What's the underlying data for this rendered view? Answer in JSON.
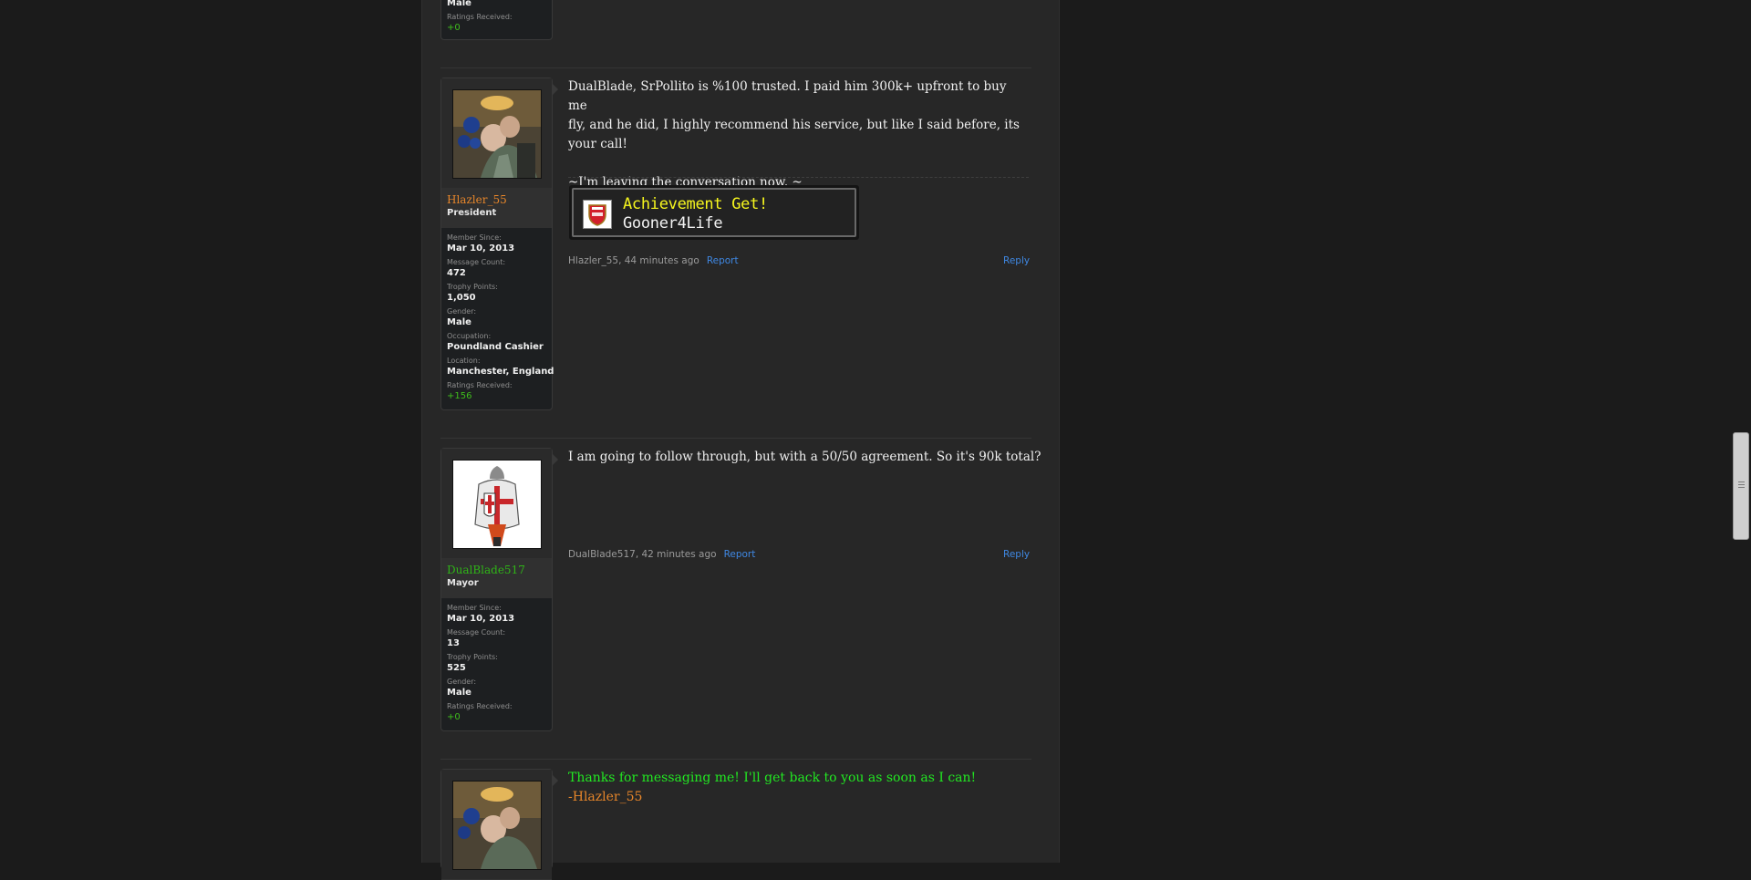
{
  "colors": {
    "page_background": "#1b1b1b",
    "content_background": "#272727",
    "president_name": "#e7862a",
    "mayor_name": "#2fb517",
    "rating_positive": "#3fbd1c",
    "link_blue": "#3f88e3",
    "auto_reply_green": "#22e822",
    "auto_reply_orange": "#e7862a",
    "achievement_yellow": "#f6f61e"
  },
  "prev_post": {
    "stats": [
      {
        "label": "",
        "value": "Male"
      },
      {
        "label": "Ratings Received:",
        "value": "+0"
      }
    ]
  },
  "posts": [
    {
      "author": {
        "username": "Hlazler_55",
        "title": "President",
        "avatar_icon": "user-photo-avatar",
        "stats": [
          {
            "label": "Member Since:",
            "value": "Mar 10, 2013"
          },
          {
            "label": "Message Count:",
            "value": "472"
          },
          {
            "label": "Trophy Points:",
            "value": "1,050"
          },
          {
            "label": "Gender:",
            "value": "Male"
          },
          {
            "label": "Occupation:",
            "value": "Poundland Cashier"
          },
          {
            "label": "Location:",
            "value": "Manchester, England"
          },
          {
            "label": "Ratings Received:",
            "value": "+156"
          }
        ]
      },
      "message_lines": [
        "DualBlade, SrPollito is %100 trusted. I paid him 300k+ upfront to buy me",
        "fly, and he did, I highly recommend his service, but like I said before, its",
        "your call!",
        "",
        "~I'm leaving the conversation now. ~"
      ],
      "signature": {
        "badge_icon": "arsenal-crest-icon",
        "title": "Achievement Get!",
        "name": "Gooner4Life"
      },
      "meta": "Hlazler_55, 44 minutes ago",
      "report_label": "Report",
      "reply_label": "Reply"
    },
    {
      "author": {
        "username": "DualBlade517",
        "title": "Mayor",
        "avatar_icon": "templar-knight-avatar",
        "stats": [
          {
            "label": "Member Since:",
            "value": "Mar 10, 2013"
          },
          {
            "label": "Message Count:",
            "value": "13"
          },
          {
            "label": "Trophy Points:",
            "value": "525"
          },
          {
            "label": "Gender:",
            "value": "Male"
          },
          {
            "label": "Ratings Received:",
            "value": "+0"
          }
        ]
      },
      "message_lines": [
        "I am going to follow through, but with a 50/50 agreement. So it's 90k total?"
      ],
      "meta": "DualBlade517, 42 minutes ago",
      "report_label": "Report",
      "reply_label": "Reply"
    },
    {
      "author": {
        "avatar_icon": "user-photo-avatar"
      },
      "auto_reply": {
        "line1": "Thanks for messaging me! I'll get back to you as soon as I can!",
        "line2": "-Hlazler_55"
      }
    }
  ]
}
